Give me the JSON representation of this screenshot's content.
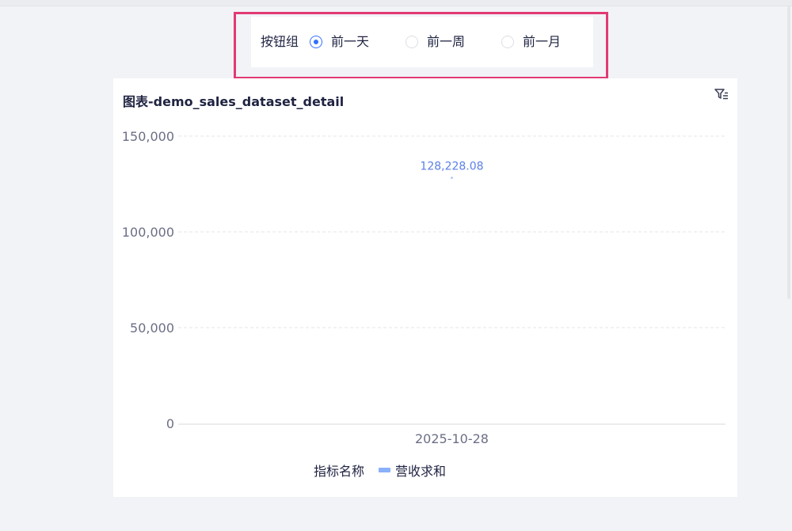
{
  "radio_group": {
    "label": "按钮组",
    "options": [
      {
        "label": "前一天",
        "checked": true
      },
      {
        "label": "前一周",
        "checked": false
      },
      {
        "label": "前一月",
        "checked": false
      }
    ]
  },
  "chart_card": {
    "title": "图表-demo_sales_dataset_detail",
    "filter_icon": "filter-icon"
  },
  "chart_data": {
    "type": "line",
    "categories": [
      "2025-10-28"
    ],
    "series": [
      {
        "name": "营收求和",
        "values": [
          128228.08
        ],
        "color": "#8bb0fa"
      }
    ],
    "data_labels": [
      "128,228.08"
    ],
    "ylim": [
      0,
      150000
    ],
    "yticks": [
      "0",
      "50,000",
      "100,000",
      "150,000"
    ],
    "grid": true,
    "legend": {
      "title": "指标名称",
      "entries": [
        "营收求和"
      ],
      "position": "bottom"
    },
    "label_color": "#5b7fe6"
  }
}
